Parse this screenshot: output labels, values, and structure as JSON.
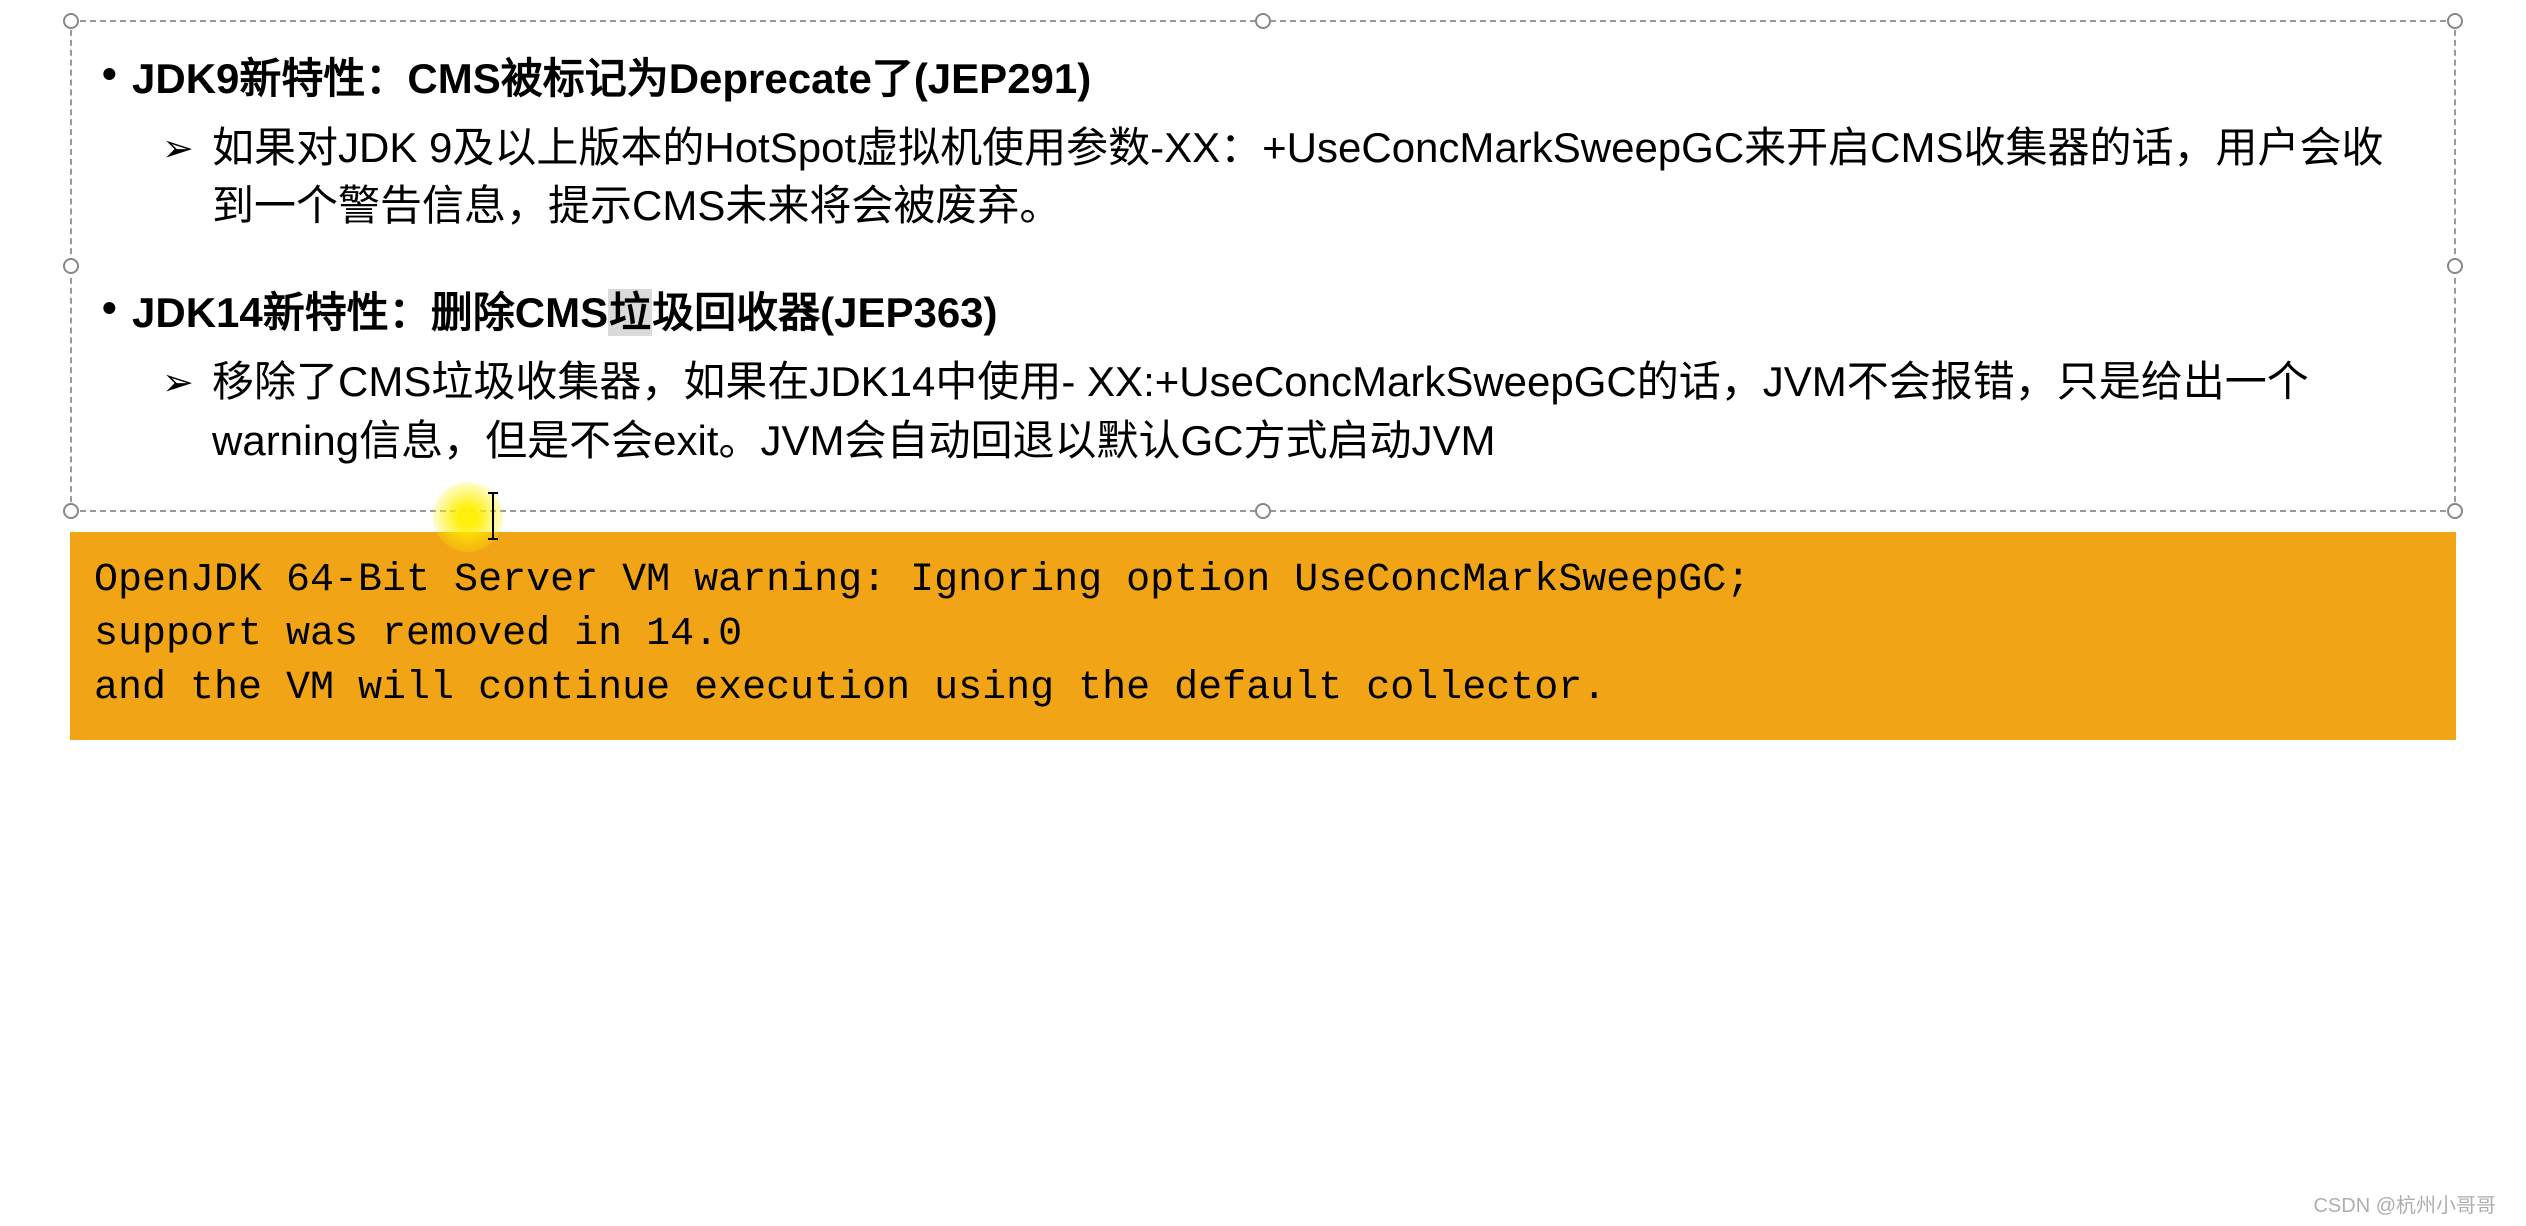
{
  "bullets": [
    {
      "title": "JDK9新特性：CMS被标记为Deprecate了(JEP291)",
      "sub": "如果对JDK 9及以上版本的HotSpot虚拟机使用参数-XX：+UseConcMarkSweepGC来开启CMS收集器的话，用户会收到一个警告信息，提示CMS未来将会被废弃。"
    },
    {
      "title_prefix": "JDK14新特性：删除CM",
      "title_highlight_s": "S",
      "title_sel": "垃",
      "title_suffix": "圾回收器(JEP363)",
      "sub": "移除了CMS垃圾收集器，如果在JDK14中使用- XX:+UseConcMarkSweepGC的话，JVM不会报错，只是给出一个warning信息，但是不会exit。JVM会自动回退以默认GC方式启动JVM"
    }
  ],
  "code_box": "OpenJDK 64-Bit Server VM warning: Ignoring option UseConcMarkSweepGC;\nsupport was removed in 14.0\nand the VM will continue execution using the default collector.",
  "watermark": "CSDN @杭州小哥哥"
}
